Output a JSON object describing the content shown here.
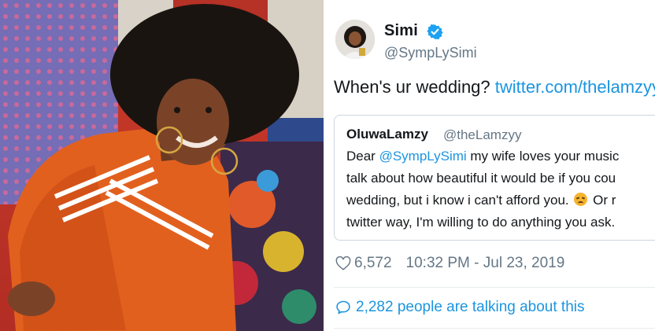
{
  "photo": {
    "icon": "woman-in-orange-tracksuit-photo"
  },
  "tweet": {
    "display_name": "Simi",
    "handle": "@SympLySimi",
    "verified_icon": "verified-badge-icon",
    "text": "When's ur wedding? ",
    "link": "twitter.com/thelamzyy",
    "quote": {
      "name": "OluwaLamzy",
      "handle": "@theLamzyy",
      "line1_prefix": "Dear ",
      "line1_mention": "@SympLySimi",
      "line1_suffix": " my wife loves your music",
      "line2": "talk about how beautiful it would be if you cou",
      "line3_prefix": "wedding, but i know i can't afford you. ",
      "line3_suffix": " Or r",
      "line4": "twitter way, I'm willing to do anything you ask."
    },
    "likes": "6,572",
    "timestamp": "10:32 PM - Jul 23, 2019",
    "talking": "2,282 people are talking about this"
  },
  "colors": {
    "link": "#1b95e0",
    "muted": "#657786",
    "text": "#14171a"
  }
}
